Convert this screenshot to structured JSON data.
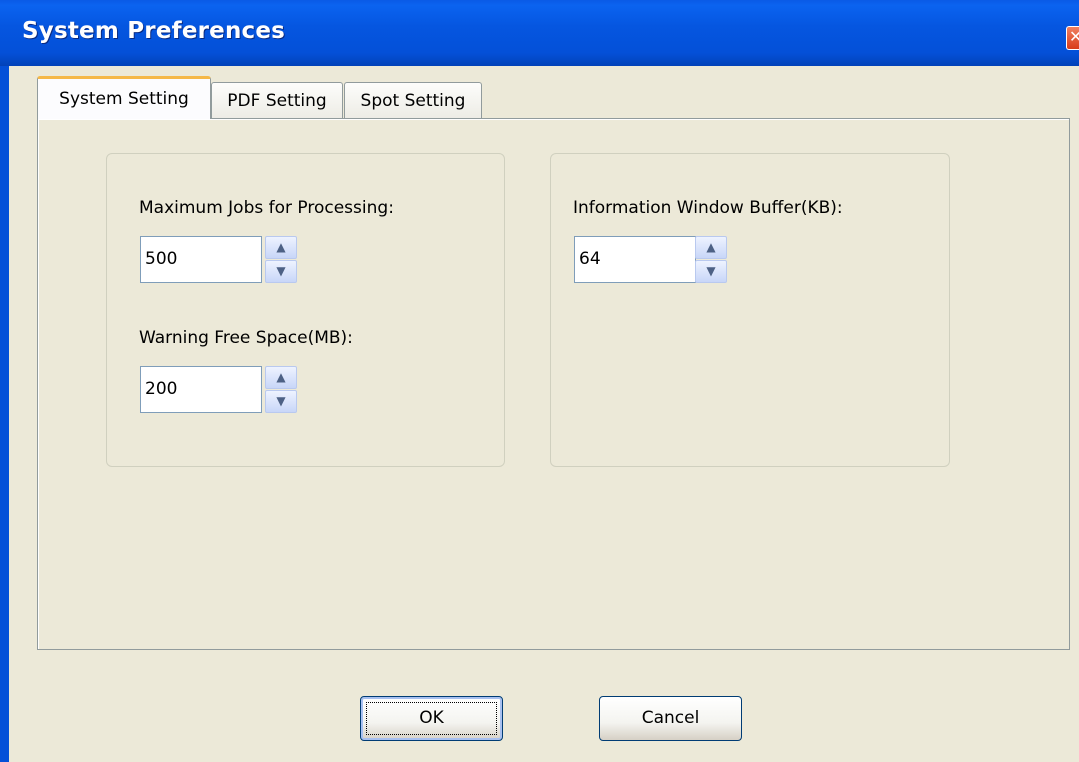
{
  "window": {
    "title": "System Preferences",
    "close_glyph": "✕"
  },
  "tabs": [
    {
      "label": "System Setting",
      "active": true
    },
    {
      "label": "PDF Setting",
      "active": false
    },
    {
      "label": "Spot Setting",
      "active": false
    }
  ],
  "left_group": {
    "max_jobs_label": "Maximum Jobs for Processing:",
    "max_jobs_value": "500",
    "warning_space_label": "Warning Free Space(MB):",
    "warning_space_value": "200"
  },
  "right_group": {
    "buffer_label": "Information Window Buffer(KB):",
    "buffer_value": "64"
  },
  "spinner": {
    "up_glyph": "▲",
    "down_glyph": "▼"
  },
  "buttons": {
    "ok_label": "OK",
    "cancel_label": "Cancel"
  },
  "colors": {
    "titlebar": "#0450d8",
    "dialog_bg": "#ece9d8",
    "active_tab_accent": "#f5b848"
  }
}
